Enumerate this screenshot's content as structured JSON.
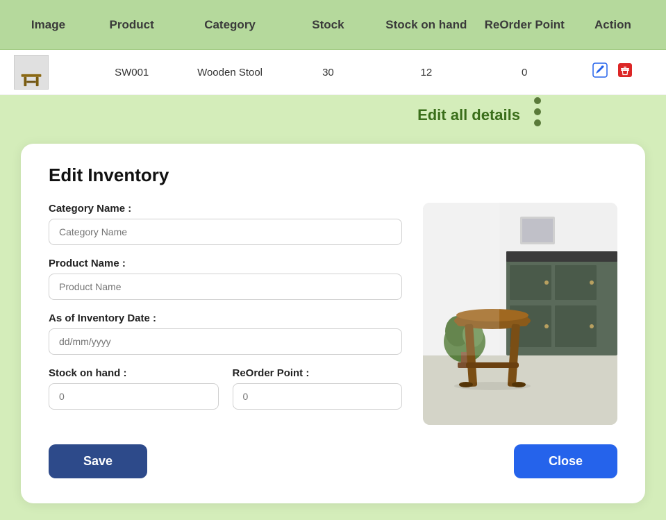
{
  "table": {
    "headers": [
      "Image",
      "Product",
      "Category",
      "Stock",
      "Stock on hand",
      "ReOrder Point",
      "Action"
    ],
    "row": {
      "product_code": "SW001",
      "category": "Wooden Stool",
      "stock": "30",
      "stock_on_hand": "12",
      "reorder_point": "0"
    }
  },
  "tooltip": {
    "label": "Edit all details"
  },
  "form": {
    "title": "Edit Inventory",
    "category_label": "Category Name :",
    "category_placeholder": "Category Name",
    "product_label": "Product Name :",
    "product_placeholder": "Product Name",
    "date_label": "As of Inventory Date :",
    "date_placeholder": "dd/mm/yyyy",
    "stock_label": "Stock on hand :",
    "stock_placeholder": "0",
    "reorder_label": "ReOrder Point :",
    "reorder_placeholder": "0"
  },
  "buttons": {
    "save": "Save",
    "close": "Close"
  }
}
